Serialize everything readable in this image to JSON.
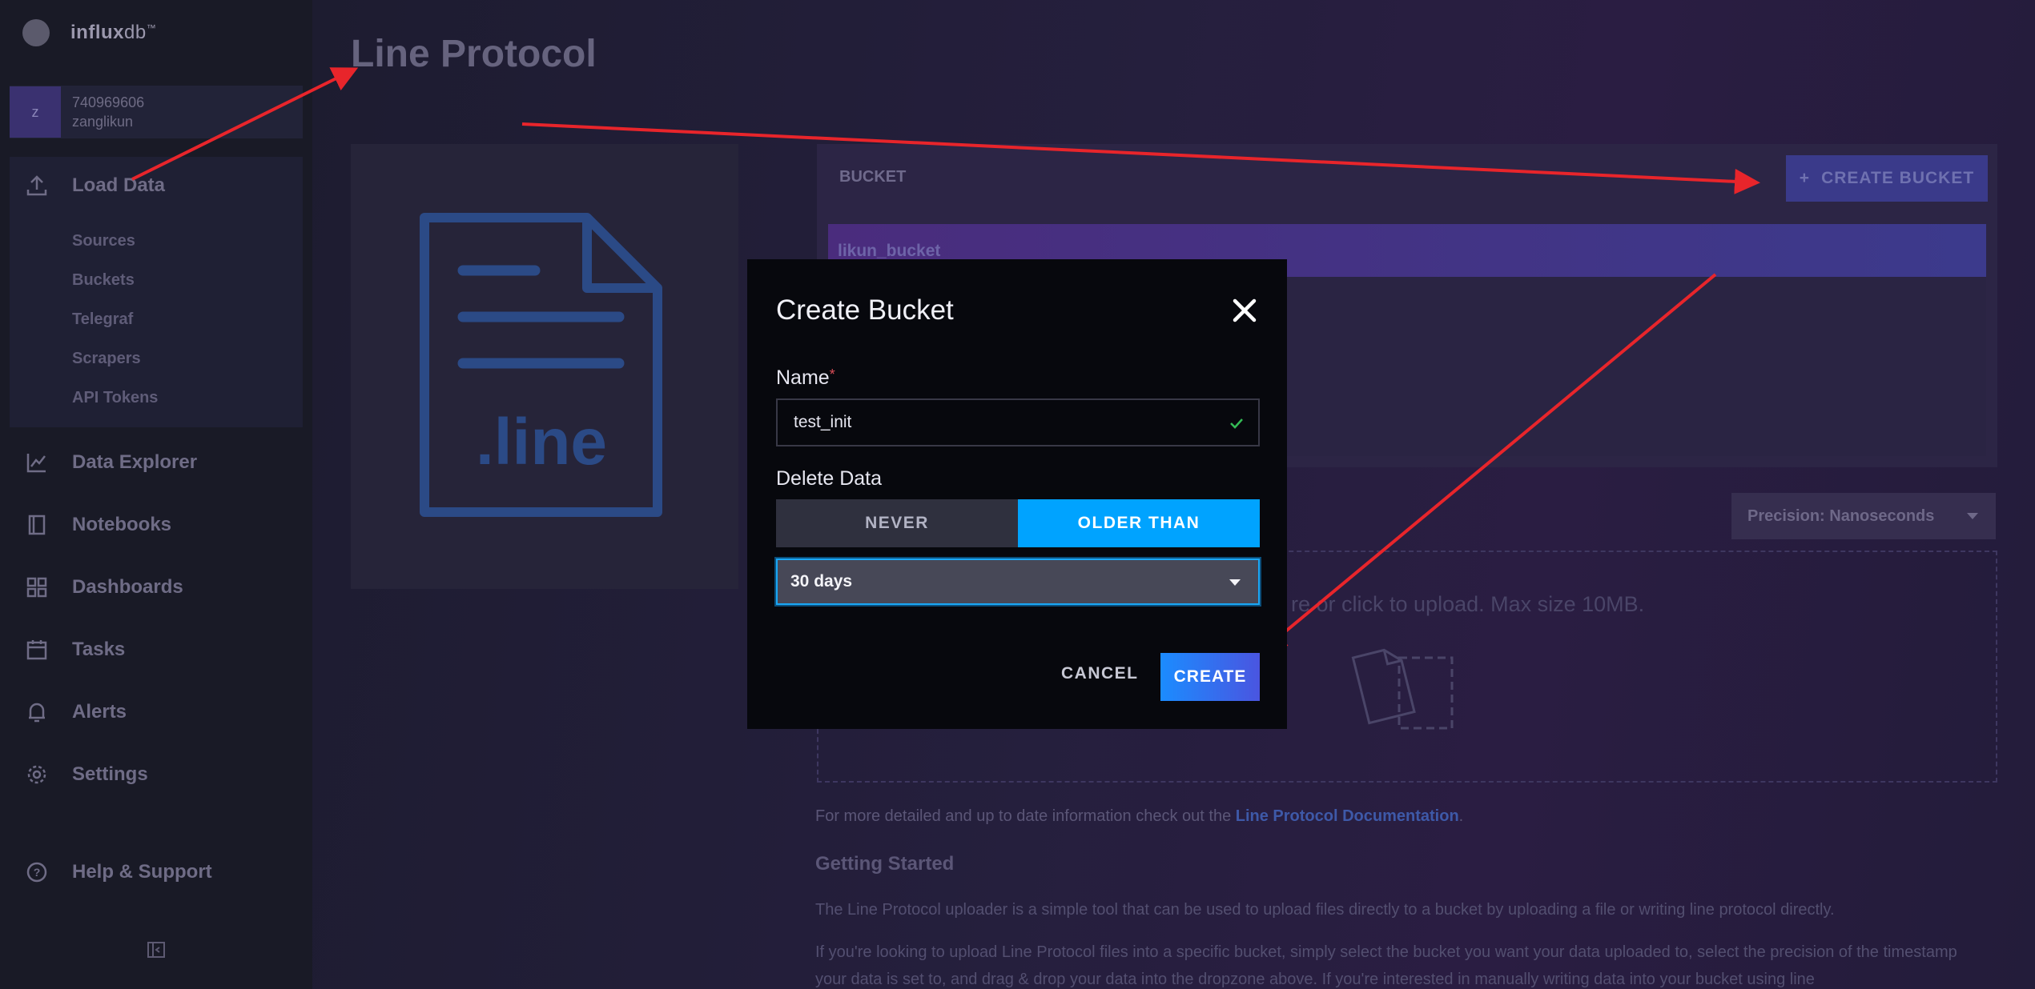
{
  "app": {
    "logo_bold": "influx",
    "logo_rest": "db",
    "logo_tm": "™"
  },
  "org": {
    "avatar_letter": "z",
    "id": "740969606",
    "user": "zanglikun"
  },
  "sidebar": {
    "load_data": "Load Data",
    "sub_items": [
      "Sources",
      "Buckets",
      "Telegraf",
      "Scrapers",
      "API Tokens"
    ],
    "items": [
      {
        "label": "Data Explorer",
        "icon": "chart-icon"
      },
      {
        "label": "Notebooks",
        "icon": "notebook-icon"
      },
      {
        "label": "Dashboards",
        "icon": "dashboards-icon"
      },
      {
        "label": "Tasks",
        "icon": "calendar-icon"
      },
      {
        "label": "Alerts",
        "icon": "bell-icon"
      },
      {
        "label": "Settings",
        "icon": "gear-icon"
      }
    ],
    "help": "Help & Support"
  },
  "page": {
    "title": "Line Protocol",
    "file_icon_text": ".line",
    "bucket_label": "BUCKET",
    "create_bucket_label": "CREATE BUCKET",
    "create_bucket_plus": "+",
    "selected_bucket": "likun_bucket",
    "precision": "Precision: Nanoseconds",
    "dropzone_text": "re or click to upload. Max size 10MB.",
    "docs_prefix": "For more detailed and up to date information check out the ",
    "docs_link": "Line Protocol Documentation",
    "docs_suffix": ".",
    "getting_started_title": "Getting Started",
    "para1": "The Line Protocol uploader is a simple tool that can be used to upload files directly to a bucket by uploading a file or writing line protocol directly.",
    "para2": "If you're looking to upload Line Protocol files into a specific bucket, simply select the bucket you want your data uploaded to, select the precision of the timestamp your data is set to, and drag & drop your data into the dropzone above. If you're interested in manually writing data into your bucket using line"
  },
  "modal": {
    "title": "Create Bucket",
    "name_label": "Name",
    "required_mark": "*",
    "name_value": "test_init",
    "delete_label": "Delete Data",
    "never_label": "NEVER",
    "older_than_label": "OLDER THAN",
    "retention_selected": "30 days",
    "cancel_label": "CANCEL",
    "create_label": "CREATE"
  },
  "colors": {
    "accent_blue": "#00a3ff",
    "annotation_red": "#e8252b",
    "success_green": "#34bb55"
  }
}
